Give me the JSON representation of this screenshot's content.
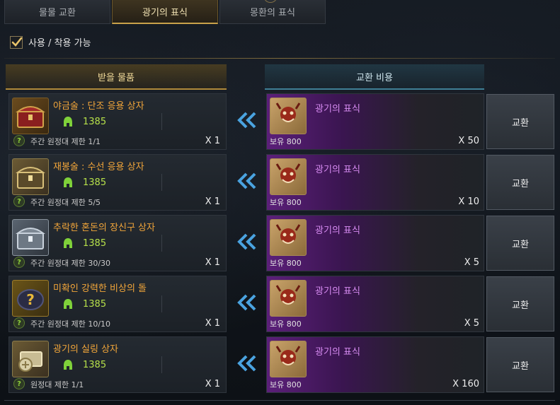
{
  "tabs": [
    {
      "label": "물물 교환",
      "active": false
    },
    {
      "label": "광기의 표식",
      "active": true
    },
    {
      "label": "몽환의 표식",
      "active": false
    }
  ],
  "filter": {
    "label": "사용 / 착용 가능",
    "checked": true
  },
  "headers": {
    "receive": "받을 물품",
    "cost": "교환 비용"
  },
  "rows": [
    {
      "item_name": "야금술 : 단조 응용 상자",
      "item_icon": "red-chest-icon",
      "price": "1385",
      "limit": "주간 원정대 제한 1/1",
      "reward_qty": "X 1",
      "cost_name": "광기의 표식",
      "owned": "보유 800",
      "cost_qty": "X 50",
      "button": "교환"
    },
    {
      "item_name": "재봉술 : 수선 응용 상자",
      "item_icon": "gold-chest-icon",
      "price": "1385",
      "limit": "주간 원정대 제한 5/5",
      "reward_qty": "X 1",
      "cost_name": "광기의 표식",
      "owned": "보유 800",
      "cost_qty": "X 10",
      "button": "교환"
    },
    {
      "item_name": "추락한 혼돈의 장신구 상자",
      "item_icon": "silver-chest-icon",
      "price": "1385",
      "limit": "주간 원정대 제한 30/30",
      "reward_qty": "X 1",
      "cost_name": "광기의 표식",
      "owned": "보유 800",
      "cost_qty": "X 5",
      "button": "교환"
    },
    {
      "item_name": "미확인 강력한 비상의 돌",
      "item_icon": "mystery-stone-icon",
      "price": "1385",
      "limit": "주간 원정대 제한 10/10",
      "reward_qty": "X 1",
      "cost_name": "광기의 표식",
      "owned": "보유 800",
      "cost_qty": "X 5",
      "button": "교환"
    },
    {
      "item_name": "광기의 실링 상자",
      "item_icon": "coin-chest-icon",
      "price": "1385",
      "limit": "원정대 제한 1/1",
      "reward_qty": "X 1",
      "cost_name": "광기의 표식",
      "owned": "보유 800",
      "cost_qty": "X 160",
      "button": "교환"
    }
  ],
  "colors": {
    "item_name": "#f3a63a",
    "price": "#b6e04a",
    "cost_name": "#d78bf2",
    "arrow": "#4aa3e0",
    "tab_active": "#c9a24a"
  }
}
